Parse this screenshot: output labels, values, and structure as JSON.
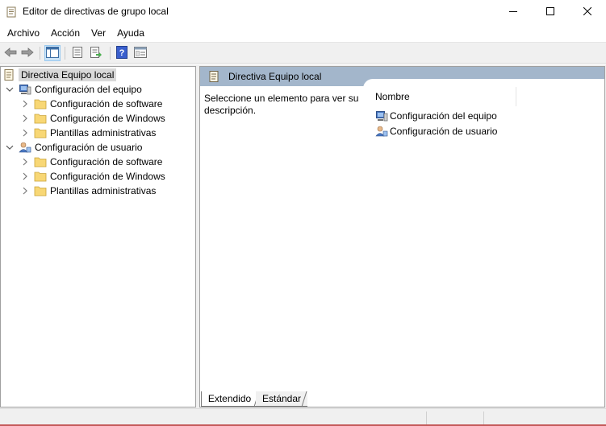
{
  "window": {
    "title": "Editor de directivas de grupo local",
    "icons": {
      "app": "policy-doc-icon",
      "minimize": "minimize-icon",
      "maximize": "maximize-icon",
      "close": "close-icon"
    }
  },
  "menu": [
    "Archivo",
    "Acción",
    "Ver",
    "Ayuda"
  ],
  "toolbar": {
    "buttons": [
      "back-arrow-icon",
      "forward-arrow-icon",
      "show-hide-tree-icon",
      "properties-icon",
      "export-list-icon",
      "help-icon",
      "extended-view-icon"
    ]
  },
  "tree": {
    "root": {
      "label": "Directiva Equipo local",
      "icon": "policy-doc-icon"
    },
    "computer": {
      "label": "Configuración del equipo",
      "icon": "computer-icon",
      "children": [
        "Configuración de software",
        "Configuración de Windows",
        "Plantillas administrativas"
      ]
    },
    "user": {
      "label": "Configuración de usuario",
      "icon": "user-icon",
      "children": [
        "Configuración de software",
        "Configuración de Windows",
        "Plantillas administrativas"
      ]
    }
  },
  "details": {
    "header_title": "Directiva Equipo local",
    "description": "Seleccione un elemento para ver su descripción.",
    "column_header": "Nombre",
    "items": [
      "Configuración del equipo",
      "Configuración de usuario"
    ]
  },
  "tabs": [
    "Extendido",
    "Estándar"
  ],
  "colors": {
    "header_bar": "#a3b6cb",
    "selection": "#d9d9d9",
    "folder": "#f8d775",
    "help": "#3a5fcd",
    "statusbar_accent": "#c45a5a"
  }
}
